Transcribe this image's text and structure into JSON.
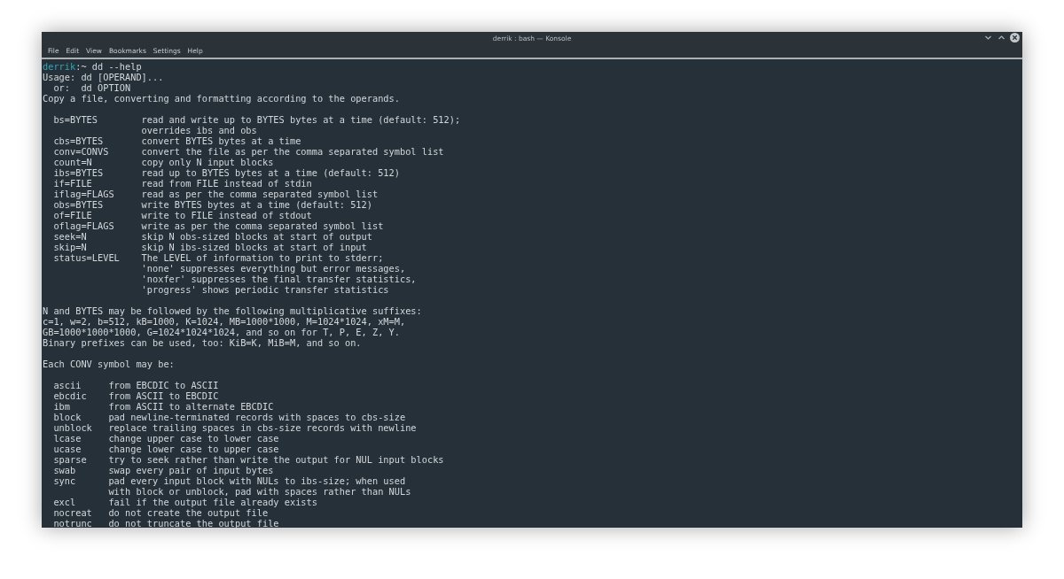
{
  "window": {
    "title": "derrik : bash — Konsole",
    "controls": [
      {
        "kind": "minimize"
      },
      {
        "kind": "maximize"
      },
      {
        "kind": "close"
      }
    ]
  },
  "menu_bar": [
    "File",
    "Edit",
    "View",
    "Bookmarks",
    "Settings",
    "Help"
  ],
  "terminal": {
    "prompt": {
      "user": "derrik",
      "rest": ":~ dd --help"
    },
    "blocks": [
      [
        "Usage: dd [OPERAND]...",
        "  or:  dd OPTION",
        "Copy a file, converting and formatting according to the operands."
      ],
      [
        "  bs=BYTES        read and write up to BYTES bytes at a time (default: 512);",
        "                  overrides ibs and obs",
        "  cbs=BYTES       convert BYTES bytes at a time",
        "  conv=CONVS      convert the file as per the comma separated symbol list",
        "  count=N         copy only N input blocks",
        "  ibs=BYTES       read up to BYTES bytes at a time (default: 512)",
        "  if=FILE         read from FILE instead of stdin",
        "  iflag=FLAGS     read as per the comma separated symbol list",
        "  obs=BYTES       write BYTES bytes at a time (default: 512)",
        "  of=FILE         write to FILE instead of stdout",
        "  oflag=FLAGS     write as per the comma separated symbol list",
        "  seek=N          skip N obs-sized blocks at start of output",
        "  skip=N          skip N ibs-sized blocks at start of input",
        "  status=LEVEL    The LEVEL of information to print to stderr;",
        "                  'none' suppresses everything but error messages,",
        "                  'noxfer' suppresses the final transfer statistics,",
        "                  'progress' shows periodic transfer statistics"
      ],
      [
        "N and BYTES may be followed by the following multiplicative suffixes:",
        "c=1, w=2, b=512, kB=1000, K=1024, MB=1000*1000, M=1024*1024, xM=M,",
        "GB=1000*1000*1000, G=1024*1024*1024, and so on for T, P, E, Z, Y.",
        "Binary prefixes can be used, too: KiB=K, MiB=M, and so on."
      ],
      [
        "Each CONV symbol may be:"
      ],
      [
        "  ascii     from EBCDIC to ASCII",
        "  ebcdic    from ASCII to EBCDIC",
        "  ibm       from ASCII to alternate EBCDIC",
        "  block     pad newline-terminated records with spaces to cbs-size",
        "  unblock   replace trailing spaces in cbs-size records with newline",
        "  lcase     change upper case to lower case",
        "  ucase     change lower case to upper case",
        "  sparse    try to seek rather than write the output for NUL input blocks",
        "  swab      swap every pair of input bytes",
        "  sync      pad every input block with NULs to ibs-size; when used",
        "            with block or unblock, pad with spaces rather than NULs",
        "  excl      fail if the output file already exists",
        "  nocreat   do not create the output file",
        "  notrunc   do not truncate the output file"
      ]
    ]
  }
}
